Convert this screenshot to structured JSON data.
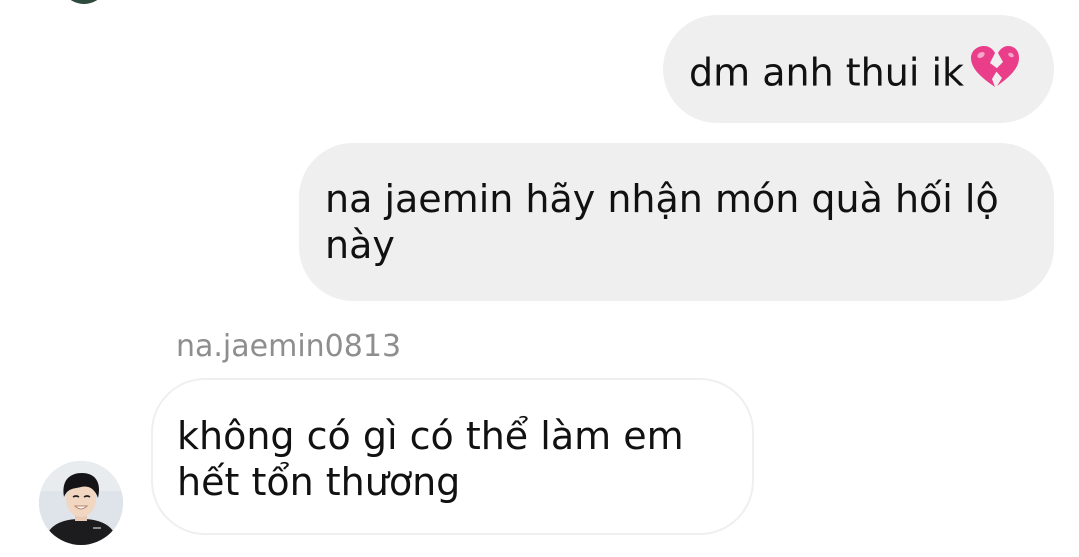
{
  "conversation": {
    "messages": [
      {
        "direction": "sent",
        "text": "dm anh thui ik",
        "emoji": "broken-heart-icon"
      },
      {
        "direction": "sent",
        "text": "na jaemin hãy nhận món quà hối lộ này"
      },
      {
        "direction": "received",
        "sender": "na.jaemin0813",
        "text": "không có gì có thể làm em hết tổn thương"
      }
    ]
  },
  "colors": {
    "sent_bubble": "#efefef",
    "received_border": "#efefef",
    "sender_name": "#8e8e8e",
    "text": "#111111",
    "heart": "#ea3d8a"
  }
}
